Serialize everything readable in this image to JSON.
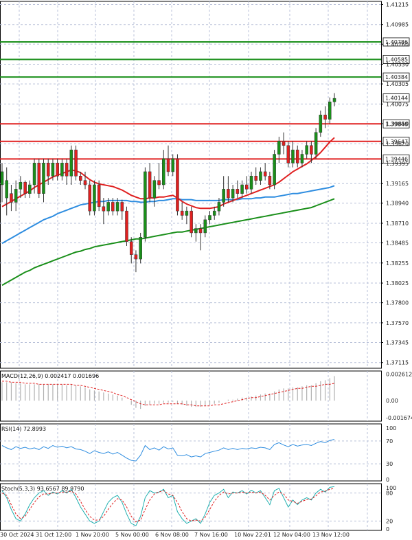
{
  "chart_data": {
    "type": "candlestick",
    "main": {
      "price_ticks": [
        "1.41215",
        "1.40985",
        "1.40760",
        "1.40530",
        "1.40305",
        "1.40075",
        "1.39850",
        "1.39620",
        "1.39395",
        "1.39165",
        "1.38940",
        "1.38710",
        "1.38485",
        "1.38255",
        "1.38025",
        "1.37800",
        "1.37570",
        "1.37345",
        "1.37115"
      ],
      "ylim": [
        1.3705,
        1.4125
      ],
      "horizontal_levels": [
        {
          "value": 1.40786,
          "label": "1.40786",
          "color": "#1a8f1a"
        },
        {
          "value": 1.40585,
          "label": "1.40585",
          "color": "#1a8f1a"
        },
        {
          "value": 1.40384,
          "label": "1.40384",
          "color": "#1a8f1a"
        },
        {
          "value": 1.39848,
          "label": "1.39848",
          "color": "#e02020"
        },
        {
          "value": 1.39647,
          "label": "1.39647",
          "color": "#e02020"
        },
        {
          "value": 1.39446,
          "label": "1.39446",
          "color": "#e02020"
        }
      ],
      "current_price": {
        "value": 1.40144,
        "label": "1.40144"
      },
      "candles": [
        {
          "o": 1.3915,
          "h": 1.394,
          "l": 1.3895,
          "c": 1.393
        },
        {
          "o": 1.39,
          "h": 1.3935,
          "l": 1.388,
          "c": 1.392
        },
        {
          "o": 1.3905,
          "h": 1.3915,
          "l": 1.3885,
          "c": 1.3895
        },
        {
          "o": 1.3895,
          "h": 1.392,
          "l": 1.3885,
          "c": 1.391
        },
        {
          "o": 1.391,
          "h": 1.3925,
          "l": 1.39,
          "c": 1.3918
        },
        {
          "o": 1.3918,
          "h": 1.392,
          "l": 1.39,
          "c": 1.3905
        },
        {
          "o": 1.3905,
          "h": 1.392,
          "l": 1.39,
          "c": 1.3915
        },
        {
          "o": 1.3915,
          "h": 1.3945,
          "l": 1.3905,
          "c": 1.394
        },
        {
          "o": 1.394,
          "h": 1.3945,
          "l": 1.39,
          "c": 1.3905
        },
        {
          "o": 1.3905,
          "h": 1.3945,
          "l": 1.3895,
          "c": 1.394
        },
        {
          "o": 1.394,
          "h": 1.3945,
          "l": 1.3915,
          "c": 1.3925
        },
        {
          "o": 1.3925,
          "h": 1.3945,
          "l": 1.392,
          "c": 1.394
        },
        {
          "o": 1.394,
          "h": 1.3945,
          "l": 1.392,
          "c": 1.3925
        },
        {
          "o": 1.3925,
          "h": 1.3945,
          "l": 1.392,
          "c": 1.394
        },
        {
          "o": 1.394,
          "h": 1.3945,
          "l": 1.3915,
          "c": 1.3925
        },
        {
          "o": 1.3925,
          "h": 1.396,
          "l": 1.3915,
          "c": 1.3955
        },
        {
          "o": 1.3955,
          "h": 1.396,
          "l": 1.392,
          "c": 1.3925
        },
        {
          "o": 1.3925,
          "h": 1.393,
          "l": 1.3915,
          "c": 1.392
        },
        {
          "o": 1.392,
          "h": 1.393,
          "l": 1.391,
          "c": 1.3915
        },
        {
          "o": 1.3915,
          "h": 1.392,
          "l": 1.388,
          "c": 1.3885
        },
        {
          "o": 1.3885,
          "h": 1.392,
          "l": 1.388,
          "c": 1.3915
        },
        {
          "o": 1.3915,
          "h": 1.392,
          "l": 1.3885,
          "c": 1.389
        },
        {
          "o": 1.389,
          "h": 1.39,
          "l": 1.387,
          "c": 1.3885
        },
        {
          "o": 1.3885,
          "h": 1.39,
          "l": 1.388,
          "c": 1.3895
        },
        {
          "o": 1.3895,
          "h": 1.39,
          "l": 1.388,
          "c": 1.3885
        },
        {
          "o": 1.3885,
          "h": 1.39,
          "l": 1.388,
          "c": 1.3895
        },
        {
          "o": 1.3895,
          "h": 1.3898,
          "l": 1.3875,
          "c": 1.3885
        },
        {
          "o": 1.3885,
          "h": 1.389,
          "l": 1.3845,
          "c": 1.385
        },
        {
          "o": 1.385,
          "h": 1.3855,
          "l": 1.3825,
          "c": 1.3835
        },
        {
          "o": 1.3835,
          "h": 1.384,
          "l": 1.3815,
          "c": 1.383
        },
        {
          "o": 1.383,
          "h": 1.386,
          "l": 1.3825,
          "c": 1.3855
        },
        {
          "o": 1.3855,
          "h": 1.3935,
          "l": 1.385,
          "c": 1.393
        },
        {
          "o": 1.393,
          "h": 1.394,
          "l": 1.3895,
          "c": 1.39
        },
        {
          "o": 1.39,
          "h": 1.3925,
          "l": 1.389,
          "c": 1.392
        },
        {
          "o": 1.392,
          "h": 1.394,
          "l": 1.391,
          "c": 1.3915
        },
        {
          "o": 1.3915,
          "h": 1.3955,
          "l": 1.391,
          "c": 1.3945
        },
        {
          "o": 1.3945,
          "h": 1.396,
          "l": 1.3925,
          "c": 1.393
        },
        {
          "o": 1.393,
          "h": 1.395,
          "l": 1.3925,
          "c": 1.3945
        },
        {
          "o": 1.3945,
          "h": 1.395,
          "l": 1.388,
          "c": 1.3885
        },
        {
          "o": 1.3885,
          "h": 1.3895,
          "l": 1.3875,
          "c": 1.388
        },
        {
          "o": 1.388,
          "h": 1.389,
          "l": 1.387,
          "c": 1.3885
        },
        {
          "o": 1.3885,
          "h": 1.389,
          "l": 1.3855,
          "c": 1.386
        },
        {
          "o": 1.386,
          "h": 1.387,
          "l": 1.385,
          "c": 1.3865
        },
        {
          "o": 1.3865,
          "h": 1.387,
          "l": 1.384,
          "c": 1.386
        },
        {
          "o": 1.386,
          "h": 1.388,
          "l": 1.3855,
          "c": 1.3875
        },
        {
          "o": 1.3875,
          "h": 1.3885,
          "l": 1.387,
          "c": 1.388
        },
        {
          "o": 1.388,
          "h": 1.389,
          "l": 1.3875,
          "c": 1.3885
        },
        {
          "o": 1.3885,
          "h": 1.39,
          "l": 1.388,
          "c": 1.3895
        },
        {
          "o": 1.3895,
          "h": 1.3925,
          "l": 1.389,
          "c": 1.391
        },
        {
          "o": 1.391,
          "h": 1.3925,
          "l": 1.3895,
          "c": 1.39
        },
        {
          "o": 1.39,
          "h": 1.3915,
          "l": 1.3895,
          "c": 1.391
        },
        {
          "o": 1.391,
          "h": 1.392,
          "l": 1.39,
          "c": 1.3905
        },
        {
          "o": 1.3905,
          "h": 1.392,
          "l": 1.39,
          "c": 1.3915
        },
        {
          "o": 1.3915,
          "h": 1.3925,
          "l": 1.3905,
          "c": 1.391
        },
        {
          "o": 1.391,
          "h": 1.393,
          "l": 1.3905,
          "c": 1.3925
        },
        {
          "o": 1.3925,
          "h": 1.3935,
          "l": 1.3915,
          "c": 1.392
        },
        {
          "o": 1.392,
          "h": 1.3935,
          "l": 1.3915,
          "c": 1.393
        },
        {
          "o": 1.393,
          "h": 1.394,
          "l": 1.392,
          "c": 1.3925
        },
        {
          "o": 1.3925,
          "h": 1.393,
          "l": 1.391,
          "c": 1.3915
        },
        {
          "o": 1.3915,
          "h": 1.3955,
          "l": 1.391,
          "c": 1.395
        },
        {
          "o": 1.395,
          "h": 1.397,
          "l": 1.394,
          "c": 1.3965
        },
        {
          "o": 1.3965,
          "h": 1.3975,
          "l": 1.395,
          "c": 1.396
        },
        {
          "o": 1.396,
          "h": 1.3965,
          "l": 1.3935,
          "c": 1.394
        },
        {
          "o": 1.394,
          "h": 1.3965,
          "l": 1.3935,
          "c": 1.3955
        },
        {
          "o": 1.3955,
          "h": 1.396,
          "l": 1.3935,
          "c": 1.394
        },
        {
          "o": 1.394,
          "h": 1.3955,
          "l": 1.3935,
          "c": 1.395
        },
        {
          "o": 1.395,
          "h": 1.3965,
          "l": 1.3945,
          "c": 1.396
        },
        {
          "o": 1.396,
          "h": 1.3965,
          "l": 1.394,
          "c": 1.395
        },
        {
          "o": 1.395,
          "h": 1.398,
          "l": 1.3945,
          "c": 1.3975
        },
        {
          "o": 1.3975,
          "h": 1.4,
          "l": 1.397,
          "c": 1.3995
        },
        {
          "o": 1.3995,
          "h": 1.4005,
          "l": 1.398,
          "c": 1.399
        },
        {
          "o": 1.399,
          "h": 1.4015,
          "l": 1.3985,
          "c": 1.401
        },
        {
          "o": 1.401,
          "h": 1.402,
          "l": 1.4005,
          "c": 1.4014
        }
      ],
      "x_ticks": [
        "30 Oct 2024",
        "31 Oct 12:00",
        "1 Nov 20:00",
        "5 Nov 00:00",
        "6 Nov 08:00",
        "7 Nov 16:00",
        "10 Nov 22:01",
        "12 Nov 04:00",
        "13 Nov 12:00"
      ],
      "ma_fast": {
        "color": "#e02020",
        "values": [
          1.389,
          1.3893,
          1.3896,
          1.3899,
          1.3902,
          1.3905,
          1.3908,
          1.3912,
          1.3915,
          1.3918,
          1.3921,
          1.3924,
          1.3926,
          1.3928,
          1.393,
          1.3932,
          1.3931,
          1.3929,
          1.3925,
          1.3921,
          1.3918,
          1.3916,
          1.3915,
          1.3914,
          1.3913,
          1.3911,
          1.3909,
          1.3906,
          1.3903,
          1.3901,
          1.3899,
          1.3899,
          1.39,
          1.39,
          1.3901,
          1.3901,
          1.3902,
          1.3903,
          1.39,
          1.3896,
          1.3893,
          1.3891,
          1.3889,
          1.3888,
          1.3888,
          1.3888,
          1.3889,
          1.389,
          1.3893,
          1.3895,
          1.3897,
          1.3899,
          1.3901,
          1.3903,
          1.3905,
          1.3907,
          1.3909,
          1.3911,
          1.3913,
          1.3915,
          1.3918,
          1.3922,
          1.3926,
          1.393,
          1.3933,
          1.3936,
          1.3939,
          1.3943,
          1.3947,
          1.3952,
          1.3958,
          1.3964,
          1.3969
        ]
      },
      "ma_mid": {
        "color": "#2e8de0",
        "values": [
          1.3848,
          1.3851,
          1.3854,
          1.3857,
          1.386,
          1.3863,
          1.3866,
          1.3869,
          1.3872,
          1.3875,
          1.3877,
          1.3879,
          1.3882,
          1.3884,
          1.3886,
          1.3888,
          1.389,
          1.3892,
          1.3893,
          1.3894,
          1.3895,
          1.3896,
          1.3896,
          1.3897,
          1.3897,
          1.3897,
          1.3897,
          1.3897,
          1.3896,
          1.3896,
          1.3895,
          1.3895,
          1.3896,
          1.3896,
          1.3897,
          1.3897,
          1.3898,
          1.3899,
          1.3899,
          1.3898,
          1.3898,
          1.3898,
          1.3897,
          1.3897,
          1.3897,
          1.3897,
          1.3897,
          1.3897,
          1.3898,
          1.3898,
          1.3898,
          1.3898,
          1.3899,
          1.3899,
          1.3899,
          1.39,
          1.39,
          1.3901,
          1.3901,
          1.3901,
          1.3902,
          1.3903,
          1.3904,
          1.3905,
          1.3905,
          1.3906,
          1.3907,
          1.3908,
          1.3909,
          1.391,
          1.3911,
          1.3912,
          1.3914
        ]
      },
      "ma_slow": {
        "color": "#1a8f1a",
        "values": [
          1.38,
          1.3803,
          1.3806,
          1.3809,
          1.3812,
          1.3815,
          1.3817,
          1.382,
          1.3822,
          1.3824,
          1.3826,
          1.3828,
          1.383,
          1.3832,
          1.3834,
          1.3836,
          1.3838,
          1.3839,
          1.3841,
          1.3842,
          1.3844,
          1.3845,
          1.3846,
          1.3847,
          1.3848,
          1.3849,
          1.385,
          1.3851,
          1.3852,
          1.3853,
          1.3853,
          1.3854,
          1.3855,
          1.3856,
          1.3857,
          1.3858,
          1.3859,
          1.386,
          1.3861,
          1.3861,
          1.3862,
          1.3863,
          1.3864,
          1.3865,
          1.3866,
          1.3867,
          1.3868,
          1.3869,
          1.387,
          1.3871,
          1.3872,
          1.3873,
          1.3874,
          1.3875,
          1.3876,
          1.3877,
          1.3878,
          1.3879,
          1.388,
          1.3881,
          1.3882,
          1.3883,
          1.3884,
          1.3885,
          1.3886,
          1.3887,
          1.3888,
          1.3889,
          1.3891,
          1.3893,
          1.3895,
          1.3897,
          1.3899
        ]
      }
    },
    "macd": {
      "label": "MACD(12,26,9) 0.002417 0.001696",
      "ticks": [
        "0.002612",
        "0.00",
        "-0.001674"
      ],
      "ylim": [
        -0.002,
        0.0029
      ],
      "hist": [
        0.0018,
        0.0018,
        0.0018,
        0.0017,
        0.0017,
        0.0016,
        0.0016,
        0.0016,
        0.0016,
        0.0016,
        0.0016,
        0.0016,
        0.0016,
        0.0016,
        0.0015,
        0.0016,
        0.0015,
        0.0014,
        0.0013,
        0.0011,
        0.001,
        0.0009,
        0.0008,
        0.0007,
        0.0006,
        0.0005,
        0.0003,
        0.0,
        -0.0004,
        -0.0007,
        -0.0008,
        -0.0005,
        -0.0004,
        -0.0003,
        -0.0003,
        -0.0002,
        -0.0002,
        -0.0001,
        -0.0003,
        -0.0004,
        -0.0005,
        -0.0006,
        -0.0006,
        -0.0006,
        -0.0005,
        -0.0004,
        -0.0003,
        -0.0002,
        0.0,
        0.0001,
        0.0001,
        0.0002,
        0.0003,
        0.0003,
        0.0004,
        0.0005,
        0.0006,
        0.0007,
        0.0007,
        0.0009,
        0.0011,
        0.0012,
        0.0012,
        0.0013,
        0.0013,
        0.0014,
        0.0015,
        0.0015,
        0.0017,
        0.0019,
        0.002,
        0.0022,
        0.0024
      ],
      "signal": [
        0.0019,
        0.0019,
        0.0018,
        0.0018,
        0.0018,
        0.0017,
        0.0017,
        0.0017,
        0.0016,
        0.0016,
        0.0016,
        0.0016,
        0.0016,
        0.0016,
        0.0016,
        0.0016,
        0.0015,
        0.0015,
        0.0014,
        0.0013,
        0.0012,
        0.0011,
        0.001,
        0.0009,
        0.0008,
        0.0006,
        0.0005,
        0.0003,
        0.0001,
        -0.0001,
        -0.0003,
        -0.0004,
        -0.0004,
        -0.0004,
        -0.0004,
        -0.0003,
        -0.0003,
        -0.0003,
        -0.0003,
        -0.0003,
        -0.0004,
        -0.0004,
        -0.0005,
        -0.0005,
        -0.0005,
        -0.0005,
        -0.0004,
        -0.0004,
        -0.0003,
        -0.0002,
        -0.0001,
        0.0,
        0.0001,
        0.0002,
        0.0003,
        0.0003,
        0.0004,
        0.0005,
        0.0006,
        0.0007,
        0.0008,
        0.0009,
        0.001,
        0.0011,
        0.0012,
        0.0012,
        0.0013,
        0.0014,
        0.0014,
        0.0015,
        0.0016,
        0.0016,
        0.0017
      ]
    },
    "rsi": {
      "label": "RSI(14) 72.8993",
      "ticks": [
        "100",
        "70",
        "30",
        "0"
      ],
      "ylim": [
        0,
        100
      ],
      "values": [
        62,
        58,
        55,
        60,
        57,
        59,
        56,
        58,
        55,
        60,
        57,
        62,
        59,
        61,
        58,
        60,
        56,
        55,
        52,
        48,
        53,
        50,
        48,
        51,
        47,
        50,
        45,
        40,
        36,
        35,
        45,
        62,
        55,
        58,
        54,
        60,
        56,
        58,
        45,
        44,
        46,
        42,
        44,
        42,
        48,
        50,
        52,
        54,
        58,
        55,
        57,
        55,
        57,
        56,
        58,
        57,
        59,
        58,
        55,
        64,
        67,
        63,
        60,
        64,
        61,
        63,
        64,
        62,
        66,
        69,
        67,
        71,
        72.9
      ]
    },
    "stoch": {
      "label": "Stoch(5,3,3) 93.6567 89.9790",
      "ticks": [
        "100",
        "80",
        "20",
        "0"
      ],
      "ylim": [
        0,
        100
      ],
      "k": [
        85,
        70,
        45,
        25,
        20,
        35,
        55,
        70,
        80,
        85,
        75,
        82,
        78,
        85,
        80,
        88,
        70,
        50,
        35,
        20,
        15,
        20,
        40,
        60,
        70,
        75,
        60,
        35,
        15,
        10,
        30,
        70,
        85,
        80,
        82,
        88,
        70,
        75,
        40,
        25,
        15,
        20,
        25,
        15,
        35,
        60,
        75,
        80,
        88,
        70,
        82,
        80,
        85,
        78,
        86,
        80,
        85,
        70,
        55,
        85,
        90,
        70,
        50,
        65,
        55,
        65,
        70,
        65,
        80,
        88,
        82,
        92,
        93.7
      ],
      "d": [
        80,
        75,
        55,
        35,
        25,
        30,
        45,
        60,
        72,
        78,
        78,
        80,
        80,
        82,
        82,
        84,
        78,
        62,
        45,
        30,
        22,
        22,
        30,
        45,
        58,
        68,
        65,
        50,
        30,
        18,
        22,
        45,
        65,
        78,
        82,
        85,
        78,
        75,
        60,
        40,
        25,
        20,
        22,
        20,
        28,
        45,
        62,
        75,
        82,
        78,
        80,
        80,
        82,
        80,
        82,
        80,
        82,
        75,
        65,
        75,
        82,
        78,
        65,
        62,
        58,
        62,
        66,
        67,
        74,
        82,
        84,
        88,
        90.0
      ]
    }
  }
}
